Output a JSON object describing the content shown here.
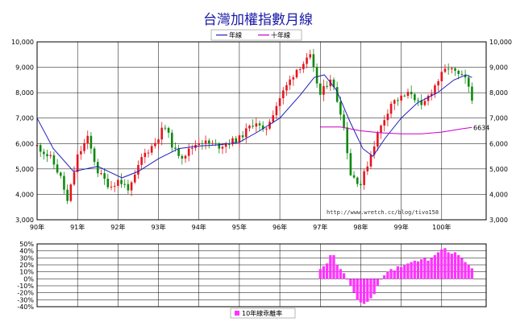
{
  "title": "台灣加權指數月線",
  "legend": {
    "annual_line": "年線",
    "ten_year_line": "十年線",
    "deviation": "10年線乖離率"
  },
  "watermark": "http://www.wretch.cc/blog/tivo158",
  "colors": {
    "title": "#1a1aa8",
    "up": "#e8141e",
    "down": "#0e8a0e",
    "annual_line": "#1e1ebe",
    "ten_year_line": "#c800c8",
    "deviation_bar": "#ff33ff",
    "frame": "#000000",
    "grid": "#000000"
  },
  "chart_data": [
    {
      "type": "candlestick",
      "title": "台灣加權指數月線",
      "ylim": [
        3000,
        10000
      ],
      "yticks": [
        "3,000",
        "4,000",
        "5,000",
        "6,000",
        "7,000",
        "8,000",
        "9,000",
        "10,000"
      ],
      "xlim": [
        90,
        101.1
      ],
      "xtick_labels": [
        "90年",
        "91年",
        "92年",
        "93年",
        "94年",
        "95年",
        "96年",
        "97年",
        "98年",
        "99年",
        "100年"
      ],
      "grid": true,
      "legend_position": "top-center",
      "anchors": [
        {
          "t": 90.0,
          "v": 5900
        },
        {
          "t": 90.35,
          "v": 5400
        },
        {
          "t": 90.6,
          "v": 4600
        },
        {
          "t": 90.75,
          "v": 3700
        },
        {
          "t": 91.0,
          "v": 5500
        },
        {
          "t": 91.25,
          "v": 6200
        },
        {
          "t": 91.5,
          "v": 4900
        },
        {
          "t": 91.8,
          "v": 4300
        },
        {
          "t": 92.0,
          "v": 4550
        },
        {
          "t": 92.3,
          "v": 4200
        },
        {
          "t": 92.6,
          "v": 5500
        },
        {
          "t": 92.9,
          "v": 6000
        },
        {
          "t": 93.15,
          "v": 6700
        },
        {
          "t": 93.4,
          "v": 5700
        },
        {
          "t": 93.6,
          "v": 5500
        },
        {
          "t": 94.0,
          "v": 6100
        },
        {
          "t": 94.5,
          "v": 5900
        },
        {
          "t": 95.0,
          "v": 6200
        },
        {
          "t": 95.4,
          "v": 6900
        },
        {
          "t": 95.6,
          "v": 6400
        },
        {
          "t": 96.0,
          "v": 7800
        },
        {
          "t": 96.4,
          "v": 8900
        },
        {
          "t": 96.75,
          "v": 9400
        },
        {
          "t": 97.0,
          "v": 7900
        },
        {
          "t": 97.25,
          "v": 8600
        },
        {
          "t": 97.55,
          "v": 7000
        },
        {
          "t": 97.75,
          "v": 4800
        },
        {
          "t": 98.0,
          "v": 4400
        },
        {
          "t": 98.4,
          "v": 6300
        },
        {
          "t": 98.75,
          "v": 7600
        },
        {
          "t": 99.0,
          "v": 7800
        },
        {
          "t": 99.25,
          "v": 8000
        },
        {
          "t": 99.5,
          "v": 7400
        },
        {
          "t": 99.8,
          "v": 8200
        },
        {
          "t": 100.0,
          "v": 8700
        },
        {
          "t": 100.15,
          "v": 9000
        },
        {
          "t": 100.4,
          "v": 8700
        },
        {
          "t": 100.6,
          "v": 8500
        },
        {
          "t": 100.75,
          "v": 7700
        }
      ],
      "series": [
        {
          "name": "年線",
          "points": [
            {
              "t": 90.0,
              "v": 7000
            },
            {
              "t": 90.4,
              "v": 5800
            },
            {
              "t": 90.9,
              "v": 4900
            },
            {
              "t": 91.5,
              "v": 5100
            },
            {
              "t": 92.1,
              "v": 4650
            },
            {
              "t": 92.5,
              "v": 4900
            },
            {
              "t": 93.0,
              "v": 5400
            },
            {
              "t": 93.5,
              "v": 5800
            },
            {
              "t": 94.0,
              "v": 5900
            },
            {
              "t": 94.5,
              "v": 5950
            },
            {
              "t": 95.0,
              "v": 6050
            },
            {
              "t": 95.5,
              "v": 6500
            },
            {
              "t": 96.0,
              "v": 7000
            },
            {
              "t": 96.5,
              "v": 7900
            },
            {
              "t": 96.85,
              "v": 8600
            },
            {
              "t": 97.1,
              "v": 8700
            },
            {
              "t": 97.4,
              "v": 8100
            },
            {
              "t": 97.75,
              "v": 6800
            },
            {
              "t": 98.05,
              "v": 5800
            },
            {
              "t": 98.3,
              "v": 5500
            },
            {
              "t": 98.6,
              "v": 6200
            },
            {
              "t": 99.0,
              "v": 7000
            },
            {
              "t": 99.4,
              "v": 7600
            },
            {
              "t": 99.9,
              "v": 8000
            },
            {
              "t": 100.3,
              "v": 8500
            },
            {
              "t": 100.6,
              "v": 8700
            },
            {
              "t": 100.75,
              "v": 8600
            }
          ]
        },
        {
          "name": "十年線",
          "points": [
            {
              "t": 97.0,
              "v": 6650
            },
            {
              "t": 97.5,
              "v": 6650
            },
            {
              "t": 98.0,
              "v": 6500
            },
            {
              "t": 98.5,
              "v": 6420
            },
            {
              "t": 99.0,
              "v": 6380
            },
            {
              "t": 99.5,
              "v": 6380
            },
            {
              "t": 100.0,
              "v": 6450
            },
            {
              "t": 100.5,
              "v": 6580
            },
            {
              "t": 100.75,
              "v": 6634
            }
          ]
        }
      ],
      "annotations": [
        {
          "text": "6634",
          "t": 100.75,
          "v": 6634
        }
      ]
    },
    {
      "type": "bar",
      "ylim": [
        -40,
        50
      ],
      "yticks": [
        "-40%",
        "-30%",
        "-20%",
        "-10%",
        "0%",
        "10%",
        "20%",
        "30%",
        "40%",
        "50%"
      ],
      "xlim": [
        90,
        101.1
      ],
      "grid": true,
      "legend_position": "bottom-left",
      "series": [
        {
          "name": "10年線乖離率",
          "x_start": 97.0,
          "x_step": 0.0833,
          "values": [
            14,
            18,
            22,
            34,
            34,
            20,
            14,
            8,
            0,
            -10,
            -20,
            -30,
            -34,
            -36,
            -33,
            -28,
            -22,
            -10,
            0,
            5,
            10,
            14,
            12,
            18,
            17,
            20,
            22,
            24,
            26,
            25,
            28,
            30,
            26,
            30,
            34,
            38,
            42,
            44,
            38,
            36,
            38,
            34,
            30,
            24,
            20,
            15
          ]
        }
      ]
    }
  ]
}
